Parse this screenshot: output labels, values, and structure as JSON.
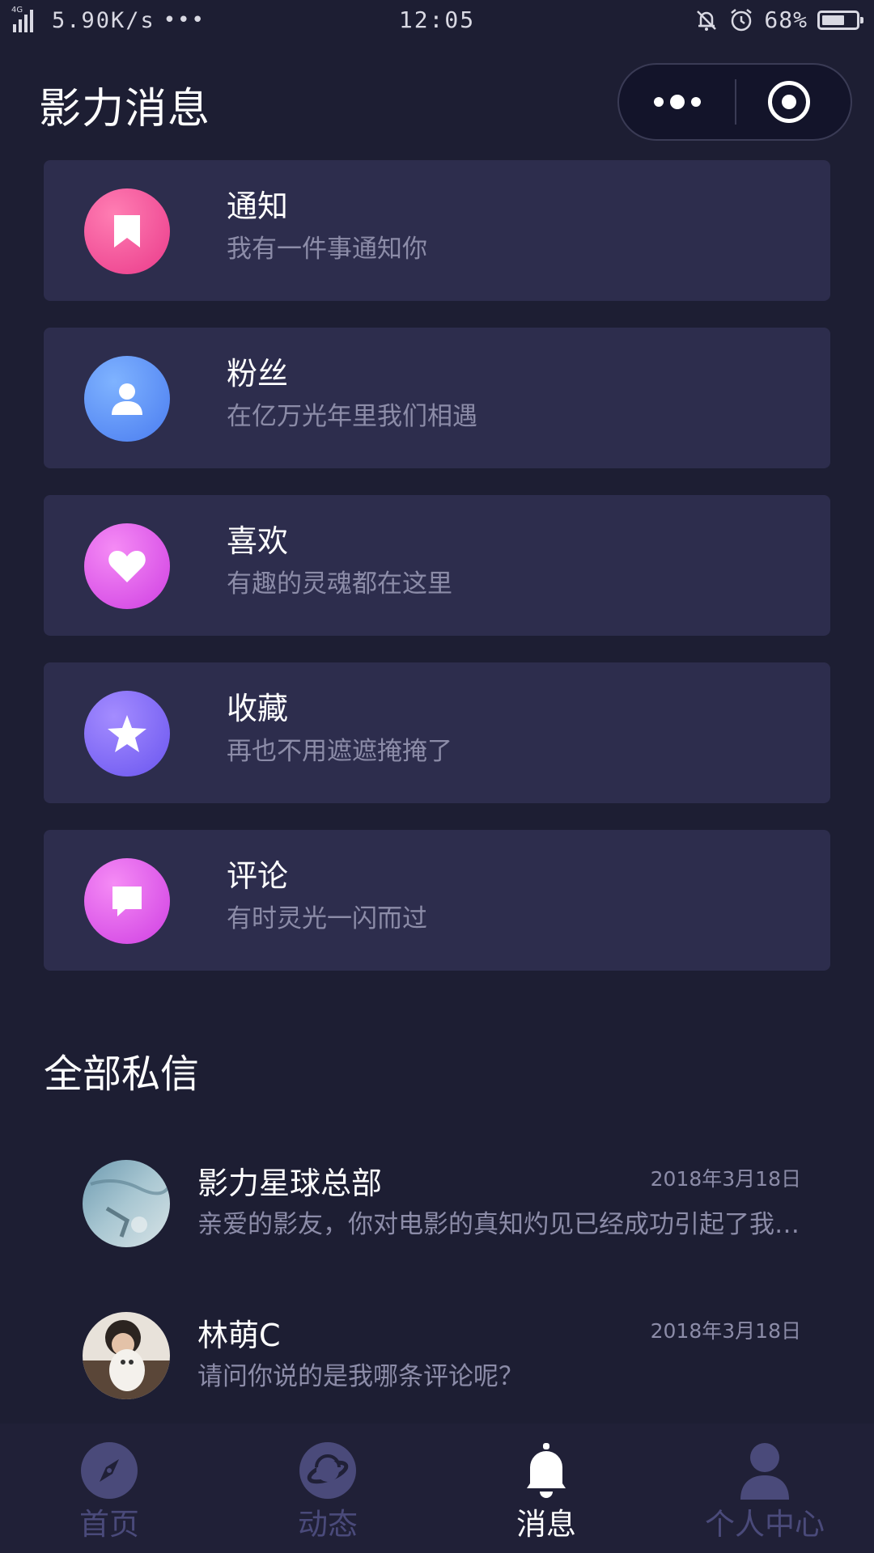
{
  "status_bar": {
    "network": "4G",
    "speed": "5.90K/s",
    "dots": "•••",
    "time": "12:05",
    "battery_percent": "68%",
    "battery_level": 0.68
  },
  "header": {
    "title": "影力消息"
  },
  "categories": [
    {
      "title": "通知",
      "subtitle": "我有一件事通知你",
      "icon": "bookmark-icon",
      "color_from": "#ff7eb3",
      "color_to": "#ea3a8a"
    },
    {
      "title": "粉丝",
      "subtitle": "在亿万光年里我们相遇",
      "icon": "user-icon",
      "color_from": "#7fb3ff",
      "color_to": "#4a7cf0"
    },
    {
      "title": "喜欢",
      "subtitle": "有趣的灵魂都在这里",
      "icon": "heart-icon",
      "color_from": "#f58bf5",
      "color_to": "#cf3fe2"
    },
    {
      "title": "收藏",
      "subtitle": "再也不用遮遮掩掩了",
      "icon": "star-icon",
      "color_from": "#a48cff",
      "color_to": "#6a55ef"
    },
    {
      "title": "评论",
      "subtitle": "有时灵光一闪而过",
      "icon": "comment-icon",
      "color_from": "#f58bf5",
      "color_to": "#cf3fe2"
    }
  ],
  "messages_section": {
    "title": "全部私信",
    "items": [
      {
        "name": "影力星球总部",
        "date": "2018年3月18日",
        "preview": "亲爱的影友，你对电影的真知灼见已经成功引起了我们的注意"
      },
      {
        "name": "林萌C",
        "date": "2018年3月18日",
        "preview": "请问你说的是我哪条评论呢？"
      }
    ]
  },
  "tabbar": {
    "tabs": [
      {
        "label": "首页",
        "icon": "compass-icon",
        "active": false
      },
      {
        "label": "动态",
        "icon": "planet-icon",
        "active": false
      },
      {
        "label": "消息",
        "icon": "bell-icon",
        "active": true
      },
      {
        "label": "个人中心",
        "icon": "person-icon",
        "active": false
      }
    ],
    "active_color": "#ffffff",
    "inactive_color": "#4a4a7a"
  }
}
